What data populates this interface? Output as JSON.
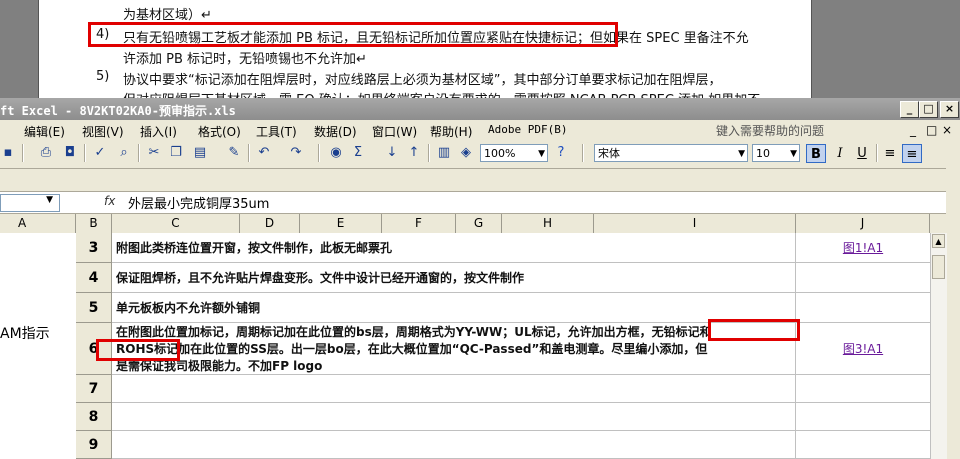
{
  "document": {
    "lines": [
      {
        "num": "",
        "text": "为基材区域）↵"
      },
      {
        "num": "4)",
        "text": "只有无铅喷锡工艺板才能添加 PB 标记，且无铅标记所加位置应紧贴在快捷标记；但如果在 SPEC 里备注不允"
      },
      {
        "num": "",
        "text": "许添加 PB 标记时，无铅喷锡也不允许加↵"
      },
      {
        "num": "5)",
        "text": "协议中要求“标记添加在阻焊层时，对应线路层上必须为基材区域”，其中部分订单要求标记加在阻焊层，"
      },
      {
        "num": "",
        "text": "但对应阻焊层下基材区域，需 EQ 确认；如果终端客户没有要求的，需要按照 NCAB PCB SPEC 添加 如果加不"
      }
    ]
  },
  "excel": {
    "title": "ft Excel - 8V2KT02KA0-预审指示.xls",
    "window_buttons": {
      "minimize": "_",
      "restore": "□",
      "close": "×"
    },
    "menus": [
      "编辑(E)",
      "视图(V)",
      "插入(I)",
      "格式(O)",
      "工具(T)",
      "数据(D)",
      "窗口(W)",
      "帮助(H)",
      "Adobe PDF(B)"
    ],
    "help_placeholder": "键入需要帮助的问题",
    "zoom": "100%",
    "font_name": "宋体",
    "font_size": "10",
    "format_buttons": {
      "bold": "B",
      "italic": "I",
      "underline": "U"
    },
    "fx_label": "fx",
    "formula_value": "外层最小完成铜厚35um",
    "columns": [
      "A",
      "B",
      "C",
      "D",
      "E",
      "F",
      "G",
      "H",
      "I",
      "J"
    ],
    "sheet_label_col_a": "AM指示",
    "rows": [
      {
        "num": "3",
        "c": "附图此类桥连位置开窗，按文件制作，此板无邮票孔",
        "j": "图1!A1"
      },
      {
        "num": "4",
        "c": "保证阻焊桥，且不允许贴片焊盘变形。文件中设计已经开通窗的，按文件制作",
        "j": ""
      },
      {
        "num": "5",
        "c": "单元板板内不允许额外铺铜",
        "j": ""
      },
      {
        "num": "6",
        "c_lines": [
          "在附图此位置加标记，周期标记加在此位置的bs层，周期格式为YY-WW；UL标记，允许加出方框，无铅标记和",
          "ROHS标记加在此位置的SS层。出一层bo层，在此大概位置加“QC-Passed”和盖电测章。尽里编小添加，但",
          "是需保证我司极限能力。不加FP logo"
        ],
        "j": "图3!A1"
      },
      {
        "num": "7",
        "c": "",
        "j": ""
      },
      {
        "num": "8",
        "c": "",
        "j": ""
      },
      {
        "num": "9",
        "c": "",
        "j": ""
      }
    ]
  }
}
